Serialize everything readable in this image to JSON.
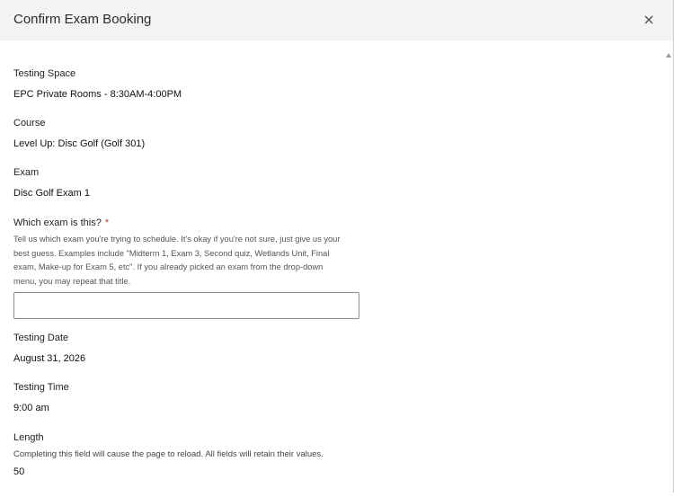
{
  "dialog": {
    "title": "Confirm Exam Booking",
    "close_icon": "close-icon"
  },
  "fields": {
    "testing_space": {
      "label": "Testing Space",
      "value": "EPC Private Rooms - 8:30AM-4:00PM"
    },
    "course": {
      "label": "Course",
      "value": "Level Up: Disc Golf (Golf 301)"
    },
    "exam": {
      "label": "Exam",
      "value": "Disc Golf Exam 1"
    },
    "which_exam": {
      "label": "Which exam is this?",
      "required_mark": "*",
      "help_lines": [
        "Tell us which exam you're trying to schedule. It's okay if you're not sure, just give us your",
        "best guess. Examples include \"Midterm 1, Exam 3, Second quiz, Wetlands Unit, Final",
        "exam, Make-up for Exam 5, etc\". If you already picked an exam from the drop-down",
        "menu, you may repeat that title."
      ],
      "value": "",
      "placeholder": ""
    },
    "testing_date": {
      "label": "Testing Date",
      "value": "August 31, 2026"
    },
    "testing_time": {
      "label": "Testing Time",
      "value": "9:00 am"
    },
    "length": {
      "label": "Length",
      "note": "Completing this field will cause the page to reload. All fields will retain their values.",
      "value": "50"
    }
  },
  "colors": {
    "header_bg": "#f3f3f3",
    "required": "#c0392b"
  }
}
